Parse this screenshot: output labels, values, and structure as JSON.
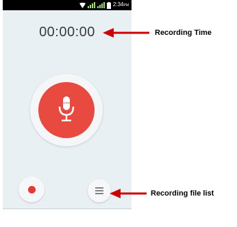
{
  "status_bar": {
    "time": "2:34",
    "ampm": "PM",
    "icons": [
      "wifi-icon",
      "signal-icon",
      "signal-icon",
      "battery-icon"
    ]
  },
  "recorder": {
    "timer": "00:00:00",
    "mic_icon": "microphone-icon",
    "record_icon": "record-dot-icon",
    "list_icon": "list-icon"
  },
  "annotations": {
    "recording_time": "Recording Time",
    "recording_file_list": "Recording file list"
  },
  "colors": {
    "accent_red": "#e84a3f",
    "arrow_red": "#cc0000",
    "screen_bg": "#e9f0f4"
  }
}
